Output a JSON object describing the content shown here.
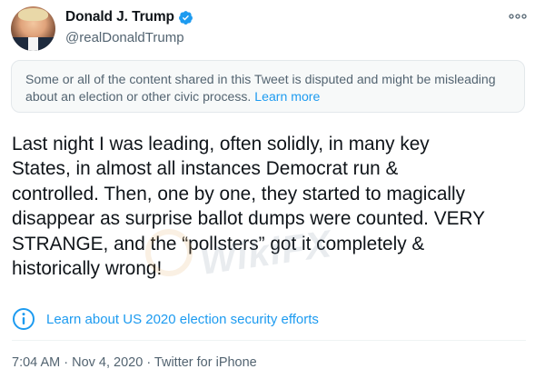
{
  "author": {
    "display_name": "Donald J. Trump",
    "handle": "@realDonaldTrump",
    "verified": true
  },
  "notice": {
    "text": "Some or all of the content shared in this Tweet is disputed and might be misleading about an election or other civic process. ",
    "link_label": "Learn more"
  },
  "tweet": {
    "text": "Last night I was leading, often solidly, in many key\nStates, in almost all instances Democrat run &\ncontrolled. Then, one by one, they started to magically\ndisappear as surprise ballot dumps were counted. VERY\nSTRANGE, and the “pollsters” got it completely &\nhistorically wrong!"
  },
  "election_link": {
    "label": "Learn about US 2020 election security efforts"
  },
  "meta": {
    "time": "7:04 AM",
    "separator": " · ",
    "date": "Nov 4, 2020",
    "source": "Twitter for iPhone"
  },
  "watermark": {
    "text": "WikiFX"
  },
  "colors": {
    "accent": "#1d9bf0",
    "text": "#0f1419",
    "secondary": "#536471",
    "notice_bg": "#f7f9f9"
  }
}
